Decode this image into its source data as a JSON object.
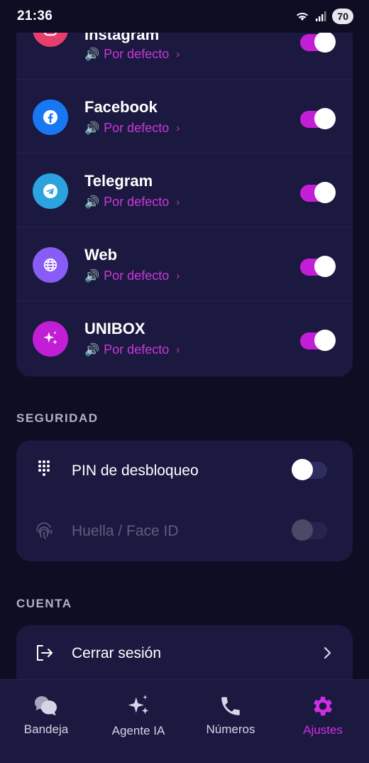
{
  "status_bar": {
    "time": "21:36",
    "battery": "70"
  },
  "apps": [
    {
      "name": "Instagram",
      "sound": "Por defecto",
      "enabled": true,
      "icon": "instagram-icon",
      "color": "#e83e6c"
    },
    {
      "name": "Facebook",
      "sound": "Por defecto",
      "enabled": true,
      "icon": "facebook-icon",
      "color": "#1877f2"
    },
    {
      "name": "Telegram",
      "sound": "Por defecto",
      "enabled": true,
      "icon": "telegram-icon",
      "color": "#2aa3df"
    },
    {
      "name": "Web",
      "sound": "Por defecto",
      "enabled": true,
      "icon": "globe-icon",
      "color": "#8a5cf6"
    },
    {
      "name": "UNIBOX",
      "sound": "Por defecto",
      "enabled": true,
      "icon": "sparkles-icon",
      "color": "#c21ed6"
    }
  ],
  "security": {
    "title": "SEGURIDAD",
    "pin_label": "PIN de desbloqueo",
    "pin_enabled": false,
    "biometric_label": "Huella / Face ID",
    "biometric_enabled": false
  },
  "account": {
    "title": "CUENTA",
    "logout_label": "Cerrar sesión"
  },
  "tabs": [
    {
      "label": "Bandeja",
      "icon": "chat-bubbles-icon",
      "active": false
    },
    {
      "label": "Agente IA",
      "icon": "sparkles-icon",
      "active": false
    },
    {
      "label": "Números",
      "icon": "phone-icon",
      "active": false
    },
    {
      "label": "Ajustes",
      "icon": "gear-icon",
      "active": true
    }
  ],
  "colors": {
    "background": "#0f0d24",
    "card": "#1b1940",
    "accent": "#c21ed6"
  }
}
